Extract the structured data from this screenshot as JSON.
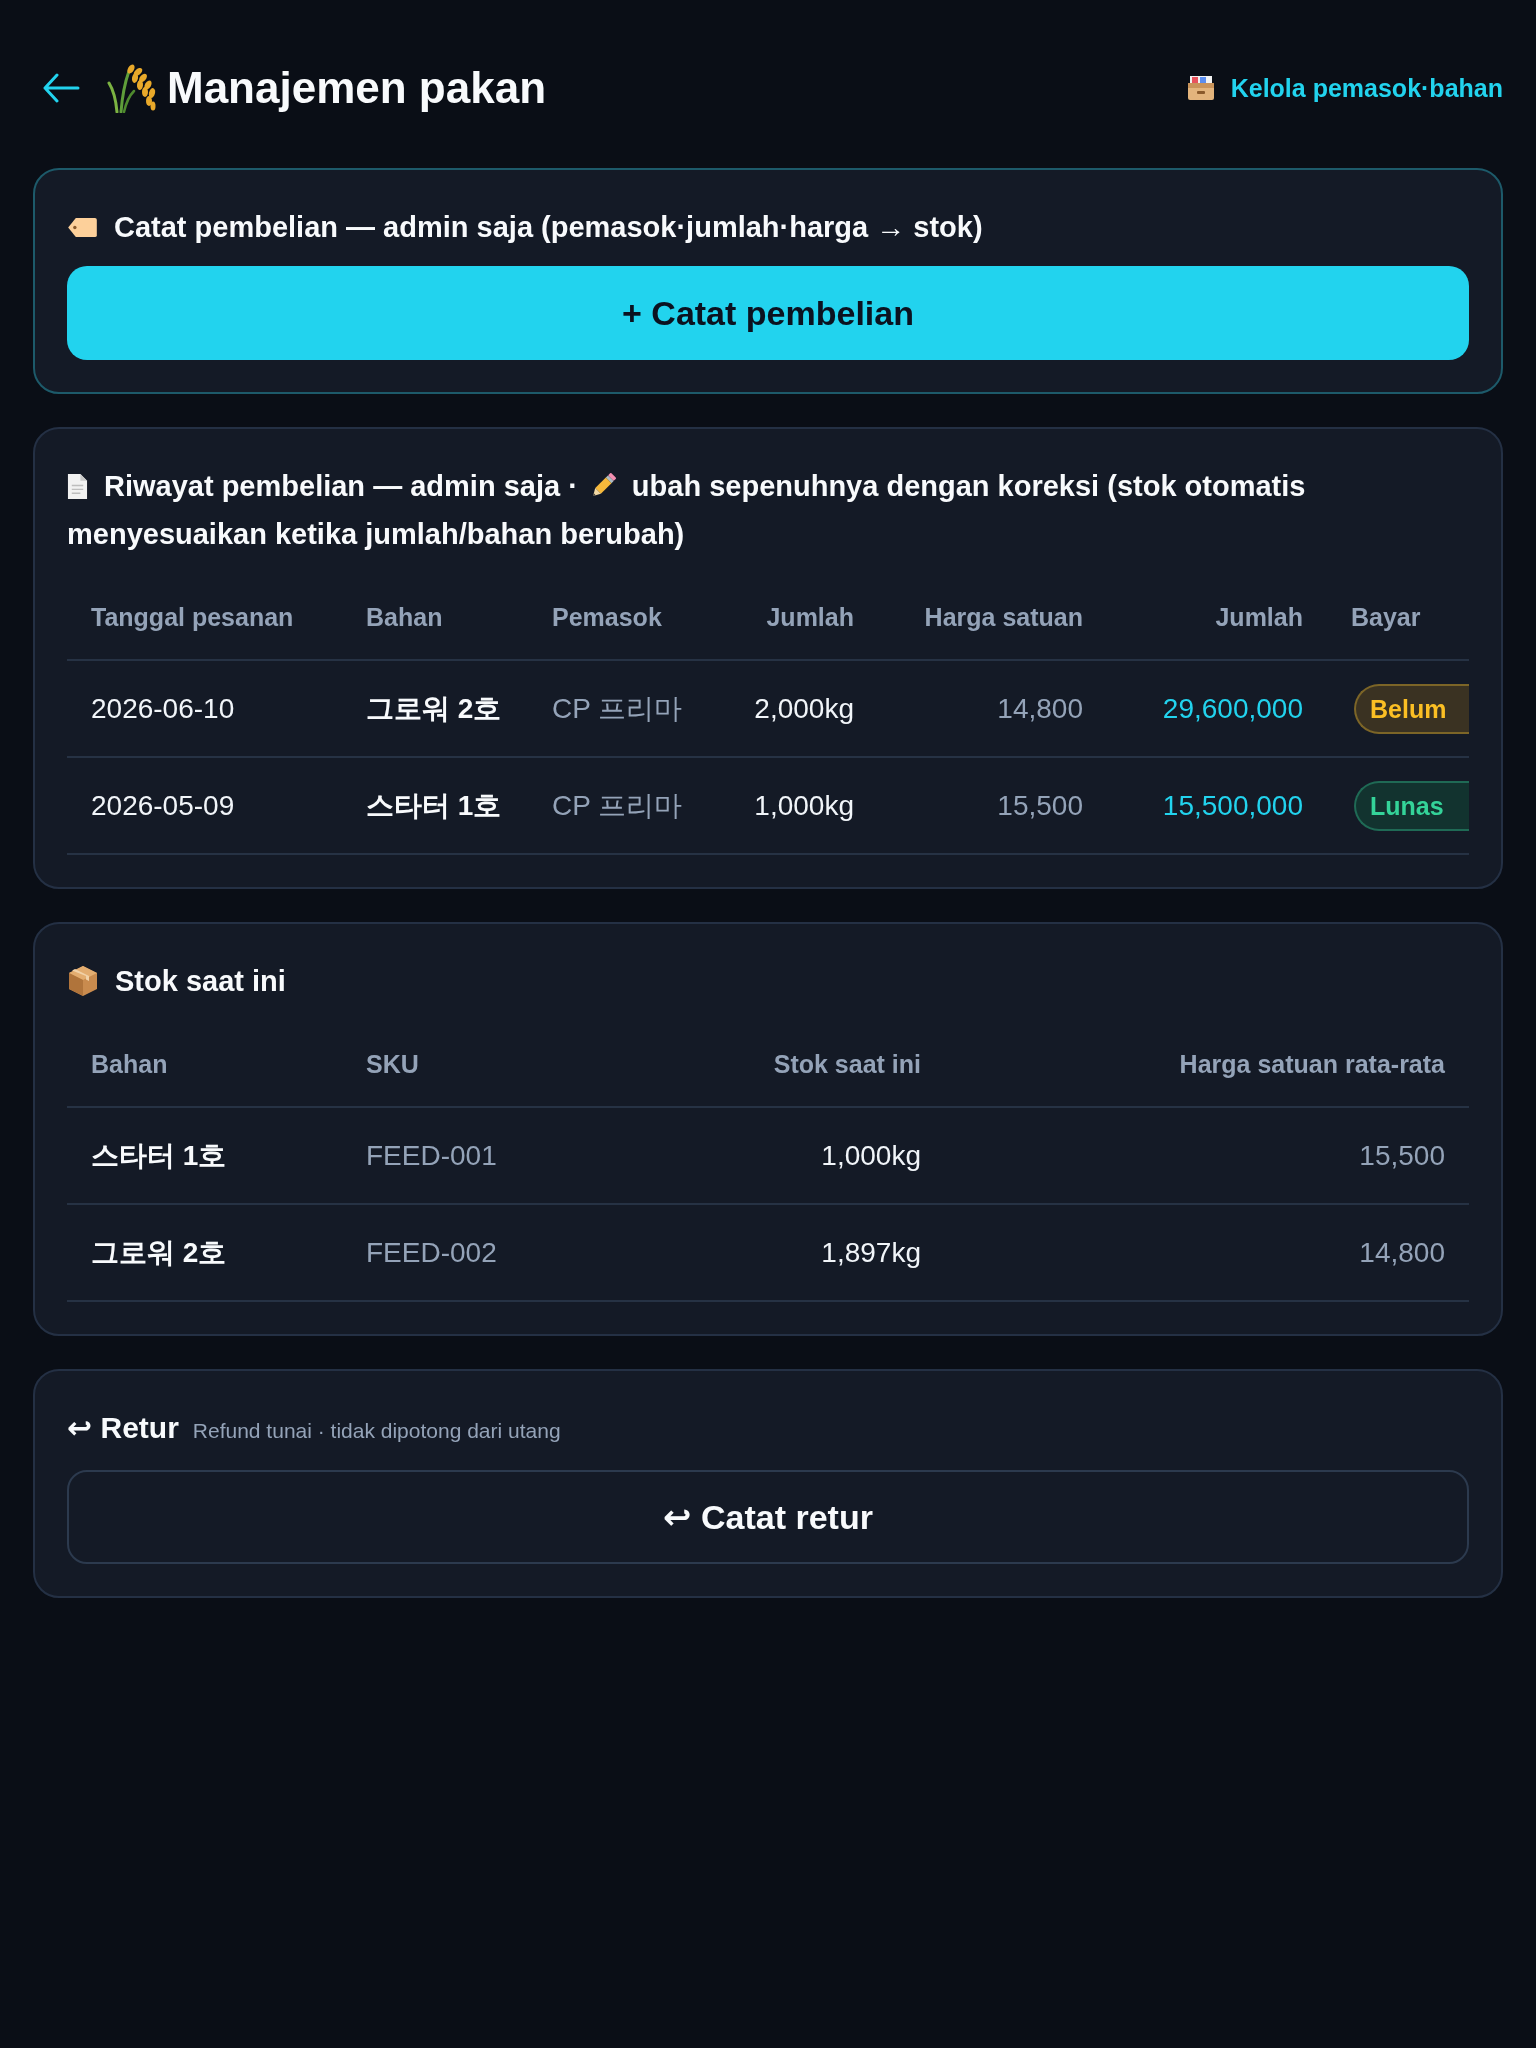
{
  "header": {
    "title": "Manajemen pakan",
    "link": "Kelola pemasok·bahan"
  },
  "purchase_entry": {
    "title": "Catat pembelian — admin saja (pemasok·jumlah·harga → stok)",
    "button": "+ Catat pembelian"
  },
  "purchase_history": {
    "title": "Riwayat pembelian — admin saja ·",
    "title_continued": "ubah sepenuhnya dengan koreksi (stok otomatis menyesuaikan ketika jumlah/bahan berubah)",
    "columns": [
      "Tanggal pesanan",
      "Bahan",
      "Pemasok",
      "Jumlah",
      "Harga satuan",
      "Jumlah",
      "Bayar"
    ],
    "rows": [
      {
        "order_date": "2026-06-10",
        "material": "그로워 2호",
        "supplier": "CP 프리마",
        "quantity": "2,000kg",
        "unit_price": "14,800",
        "total": "29,600,000",
        "payment": {
          "label": "Belum",
          "kind": "unpaid"
        }
      },
      {
        "order_date": "2026-05-09",
        "material": "스타터 1호",
        "supplier": "CP 프리마",
        "quantity": "1,000kg",
        "unit_price": "15,500",
        "total": "15,500,000",
        "payment": {
          "label": "Lunas",
          "kind": "paid"
        }
      }
    ]
  },
  "stock": {
    "title": "Stok saat ini",
    "columns": [
      "Bahan",
      "SKU",
      "Stok saat ini",
      "Harga satuan rata-rata"
    ],
    "rows": [
      {
        "material": "스타터 1호",
        "sku": "FEED-001",
        "stock": "1,000kg",
        "avg_unit_price": "15,500"
      },
      {
        "material": "그로워 2호",
        "sku": "FEED-002",
        "stock": "1,897kg",
        "avg_unit_price": "14,800"
      }
    ]
  },
  "returns": {
    "title": "↩ Retur",
    "note": "Refund tunai · tidak dipotong dari utang",
    "button": "↩ Catat retur"
  }
}
